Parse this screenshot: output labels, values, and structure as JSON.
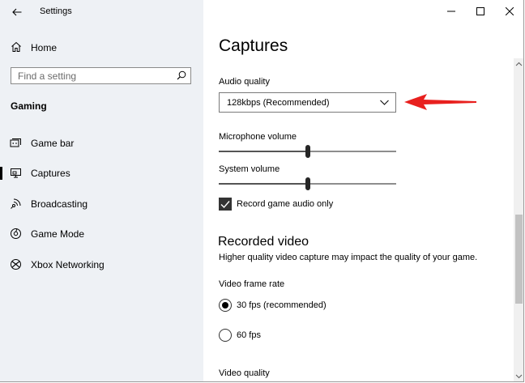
{
  "window": {
    "title": "Settings"
  },
  "sidebar": {
    "home_label": "Home",
    "search_placeholder": "Find a setting",
    "section_label": "Gaming",
    "items": [
      {
        "label": "Game bar",
        "icon": "game-bar-icon"
      },
      {
        "label": "Captures",
        "icon": "captures-icon",
        "active": true
      },
      {
        "label": "Broadcasting",
        "icon": "broadcasting-icon"
      },
      {
        "label": "Game Mode",
        "icon": "game-mode-icon"
      },
      {
        "label": "Xbox Networking",
        "icon": "xbox-icon"
      }
    ]
  },
  "main": {
    "title": "Captures",
    "audio_quality": {
      "label": "Audio quality",
      "selected": "128kbps (Recommended)"
    },
    "microphone_volume": {
      "label": "Microphone volume",
      "value_percent": 50
    },
    "system_volume": {
      "label": "System volume",
      "value_percent": 50
    },
    "record_game_audio": {
      "label": "Record game audio only",
      "checked": true
    },
    "recorded_video": {
      "title": "Recorded video",
      "description": "Higher quality video capture may impact the quality of your game."
    },
    "video_frame_rate": {
      "label": "Video frame rate",
      "options": [
        {
          "label": "30 fps (recommended)",
          "selected": true
        },
        {
          "label": "60 fps",
          "selected": false
        }
      ]
    },
    "video_quality": {
      "label": "Video quality"
    }
  },
  "colors": {
    "sidebar_bg": "#eef1f5",
    "annotation_arrow": "#e8201e",
    "control_dark": "#262626"
  }
}
